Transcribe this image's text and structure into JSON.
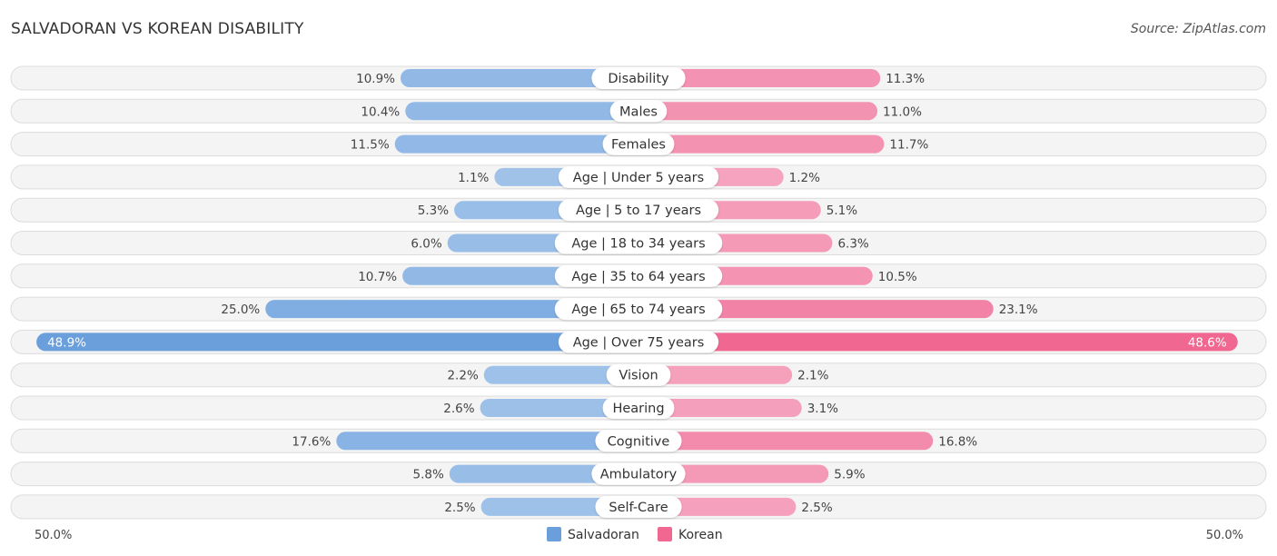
{
  "header": {
    "title": "SALVADORAN VS KOREAN DISABILITY",
    "source": "Source: ZipAtlas.com"
  },
  "chart_data": {
    "type": "bar",
    "orientation": "horizontal-diverging",
    "title": "SALVADORAN VS KOREAN DISABILITY",
    "categories": [
      "Disability",
      "Males",
      "Females",
      "Age | Under 5 years",
      "Age | 5 to 17 years",
      "Age | 18 to 34 years",
      "Age | 35 to 64 years",
      "Age | 65 to 74 years",
      "Age | Over 75 years",
      "Vision",
      "Hearing",
      "Cognitive",
      "Ambulatory",
      "Self-Care"
    ],
    "series": [
      {
        "name": "Salvadoran",
        "color": "#6a9fdc",
        "values": [
          10.9,
          10.4,
          11.5,
          1.1,
          5.3,
          6.0,
          10.7,
          25.0,
          48.9,
          2.2,
          2.6,
          17.6,
          5.8,
          2.5
        ],
        "labels": [
          "10.9%",
          "10.4%",
          "11.5%",
          "1.1%",
          "5.3%",
          "6.0%",
          "10.7%",
          "25.0%",
          "48.9%",
          "2.2%",
          "2.6%",
          "17.6%",
          "5.8%",
          "2.5%"
        ]
      },
      {
        "name": "Korean",
        "color": "#f06792",
        "values": [
          11.3,
          11.0,
          11.7,
          1.2,
          5.1,
          6.3,
          10.5,
          23.1,
          48.6,
          2.1,
          3.1,
          16.8,
          5.9,
          2.5
        ],
        "labels": [
          "11.3%",
          "11.0%",
          "11.7%",
          "1.2%",
          "5.1%",
          "6.3%",
          "10.5%",
          "23.1%",
          "48.6%",
          "2.1%",
          "3.1%",
          "16.8%",
          "5.9%",
          "2.5%"
        ]
      }
    ],
    "axis": {
      "left_label": "50.0%",
      "right_label": "50.0%",
      "range": [
        0,
        50
      ]
    },
    "legend": {
      "position": "bottom-center",
      "entries": [
        "Salvadoran",
        "Korean"
      ]
    },
    "grid": false
  }
}
